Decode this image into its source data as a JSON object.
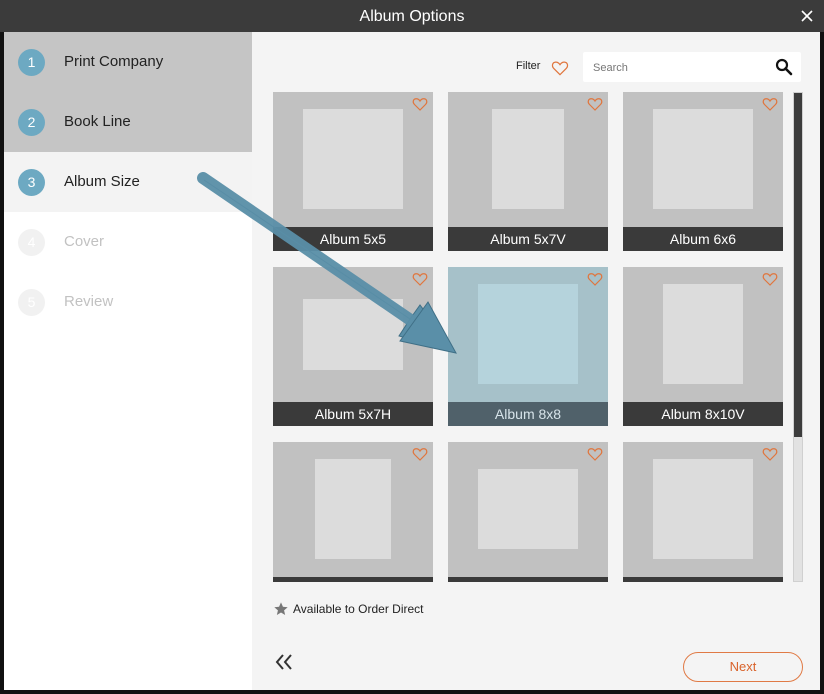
{
  "dialog": {
    "title": "Album Options"
  },
  "colors": {
    "accent": "#6da9c2",
    "heart": "#e0763e",
    "next": "#d9622a",
    "arrow": "#5a8fa8"
  },
  "steps": [
    {
      "number": "1",
      "label": "Print Company",
      "state": "done"
    },
    {
      "number": "2",
      "label": "Book Line",
      "state": "done"
    },
    {
      "number": "3",
      "label": "Album Size",
      "state": "active"
    },
    {
      "number": "4",
      "label": "Cover",
      "state": "pending"
    },
    {
      "number": "5",
      "label": "Review",
      "state": "pending"
    }
  ],
  "toolbar": {
    "filter_label": "Filter",
    "filter_icon": "heart-outline-icon",
    "search_placeholder": "Search",
    "search_icon": "magnifier-icon"
  },
  "albums": [
    {
      "label": "Album 5x5",
      "selected": false
    },
    {
      "label": "Album 5x7V",
      "selected": false
    },
    {
      "label": "Album 6x6",
      "selected": false
    },
    {
      "label": "Album 5x7H",
      "selected": false
    },
    {
      "label": "Album 8x8",
      "selected": true
    },
    {
      "label": "Album 8x10V",
      "selected": false
    },
    {
      "label": "",
      "selected": false
    },
    {
      "label": "",
      "selected": false
    },
    {
      "label": "",
      "selected": false
    }
  ],
  "legend": {
    "icon": "star-icon",
    "text": "Available to Order Direct"
  },
  "footer": {
    "back_icon": "double-chevron-left-icon",
    "next_label": "Next"
  }
}
